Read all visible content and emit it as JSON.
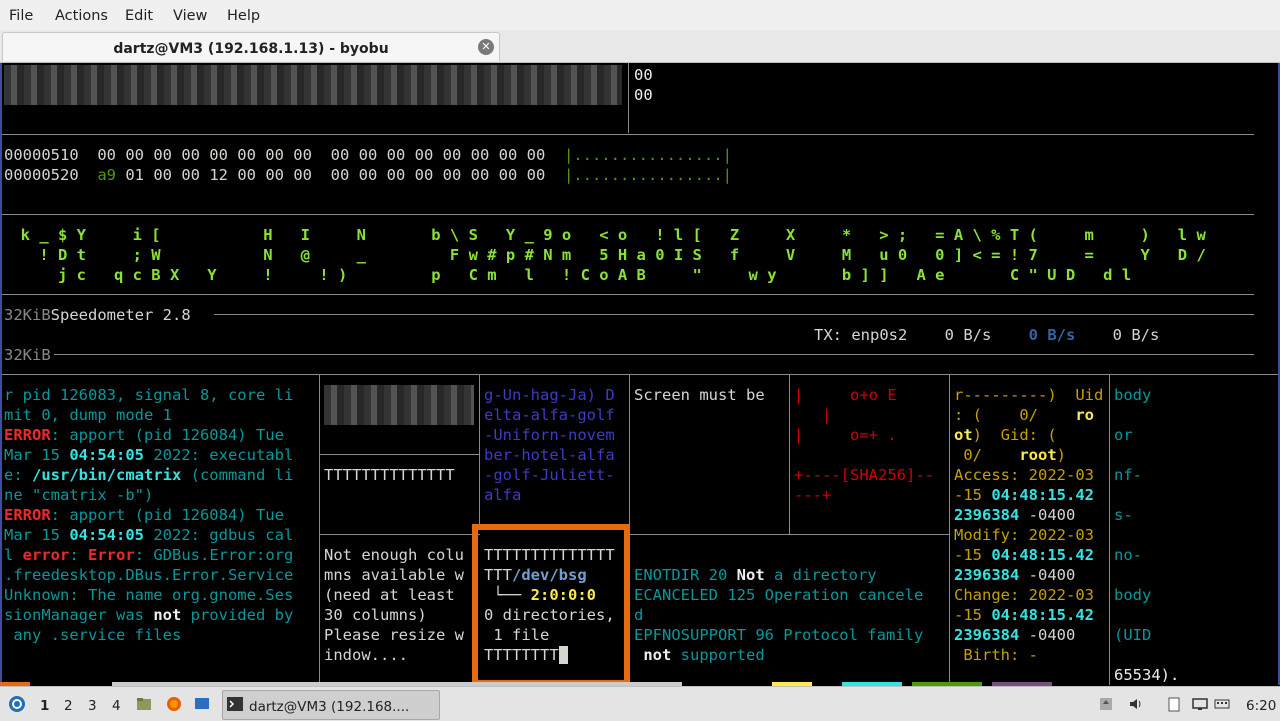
{
  "menu": {
    "file": "File",
    "actions": "Actions",
    "edit": "Edit",
    "view": "View",
    "help": "Help"
  },
  "tab": {
    "title": "dartz@VM3 (192.168.1.13) - byobu"
  },
  "hexdump": {
    "top_right": [
      "00",
      "00"
    ],
    "line1": {
      "addr": "00000510",
      "bytes_a": "00 00 00 00 00 00 00 00",
      "bytes_b": "00 00 00 00 00 00 00 00",
      "ascii": "|................|"
    },
    "line2": {
      "addr": "00000520",
      "first": "a9",
      "bytes_a_rest": "01 00 00 12 00 00 00",
      "bytes_b": "00 00 00 00 00 00 00 00",
      "ascii": "|................|"
    }
  },
  "matrix": {
    "row1": "  k _ $ Y     i [           H   I     N       b \\ S   Y _ 9 o   < o   ! l [   Z     X     *   > ;   = A \\ % T (     m     )   l w",
    "row2": "    ! D t     ; W           N   @     _         F w # p # N m   5 H a 0 I S   f     V     M   u 0   0 ] < = ! 7     =     Y   D /",
    "row3": "      j c   q c B X   Y     !     ! )         p   C m   l   ! C o A B     \"     w y       b ] ]   A e       C \" U D   d l"
  },
  "speedometer": {
    "unit1": "32KiB",
    "title": "Speedometer 2.8",
    "tx_label": "TX: enp0s2",
    "tx_val": "0 B/s",
    "tx_val2": "0 B/s",
    "tx_val3": "0 B/s",
    "unit2": "32KiB"
  },
  "log_pane": {
    "l1": "r pid 126083, signal 8, core li",
    "l2": "mit 0, dump mode 1",
    "err": "ERROR",
    "l3b": ": apport (pid 126084) Tue",
    "l4a": "Mar 15 ",
    "l4t": "04:54:05",
    "l4b": " 2022: executabl",
    "l5a": "e: ",
    "l5p": "/usr/bin/cmatrix",
    "l5b": " (command li",
    "l6": "ne \"cmatrix -b\")",
    "l7b": ": apport (pid 126084) Tue",
    "l8a": "Mar 15 ",
    "l8t": "04:54:05",
    "l8b": " 2022: gdbus cal",
    "l9a": "l ",
    "l9e": "error",
    "l9m": ": ",
    "l9E": "Error",
    ":l9c": "",
    "l9c": ": GDBus.Error:org",
    "l10": ".freedesktop.DBus.Error.Service",
    "l11": "Unknown: The name org.gnome.Ses",
    "l12a": "sionManager was ",
    "l12n": "not",
    "l12b": " provided by",
    "l13": " any .service files"
  },
  "t_pane": {
    "line": "TTTTTTTTTTTTTT"
  },
  "nato_pane": [
    "g-Un-hag-Ja) D",
    "elta-alfa-golf",
    "-Uniforn-novem",
    "ber-hotel-alfa",
    "-golf-Juliett-",
    "alfa"
  ],
  "screen_pane": {
    "l1": "Screen must be"
  },
  "sha_pane": [
    "|     o+o E",
    "   |",
    "|     o=+ .",
    "",
    "+----[SHA256]--",
    "---+"
  ],
  "stat_pane": {
    "l1a": "r---------)  Uid",
    "l2a": ": (    0/    ",
    "l2b": "ro",
    "l3a": "ot",
    "l3b": ")  Gid: (",
    "l4a": " 0/    ",
    "l4b": "root",
    ")": ")",
    "l5a": "Access: 2022-03",
    "l6a": "-15 ",
    "l6b": "04:48:15.42",
    "l7a": "2396384",
    "l7b": " -0400",
    "l8a": "Modify: 2022-03",
    "l9a": "-15 ",
    "l9b": "04:48:15.42",
    "l10a": "2396384",
    "l10b": " -0400",
    "l11a": "Change: 2022-03",
    "l12a": "-15 ",
    "l12b": "04:48:15.42",
    "l13a": "2396384",
    "l13b": " -0400",
    "l14a": " Birth: -"
  },
  "body_pane": [
    "body",
    "",
    "or",
    "",
    "nf-",
    "",
    "s-",
    "",
    "no-",
    "",
    "body",
    "",
    "(UID",
    "",
    "65534)."
  ],
  "cols_pane": [
    "Not enough colu",
    "mns available w",
    "(need at least",
    "30 columns)",
    "Please resize w",
    "indow...."
  ],
  "tree_pane": {
    "l1": "TTTTTTTTTTTTTT",
    "l2a": "TTT",
    "l2b": "/dev/bsg",
    "l3a": " └── ",
    "l3b": "2:0:0:0",
    "l4": "0 directories,",
    "l5": " 1 file",
    "l6": "TTTTTTTT"
  },
  "errno_pane": {
    "l1a": "ENOTDIR 20 ",
    "l1b": "Not",
    " l1c": "",
    "l1c": " a directory",
    "l2": "ECANCELED 125 Operation cancele",
    "l3": "d",
    "l4": "EPFNOSUPPORT 96 Protocol family",
    "l5a": " ",
    "l5b": "not",
    "l5c": " supported"
  },
  "taskbar": {
    "ws1": "1",
    "ws2": "2",
    "ws3": "3",
    "ws4": "4",
    "task_label": "dartz@VM3 (192.168....",
    "clock": "6:20"
  }
}
